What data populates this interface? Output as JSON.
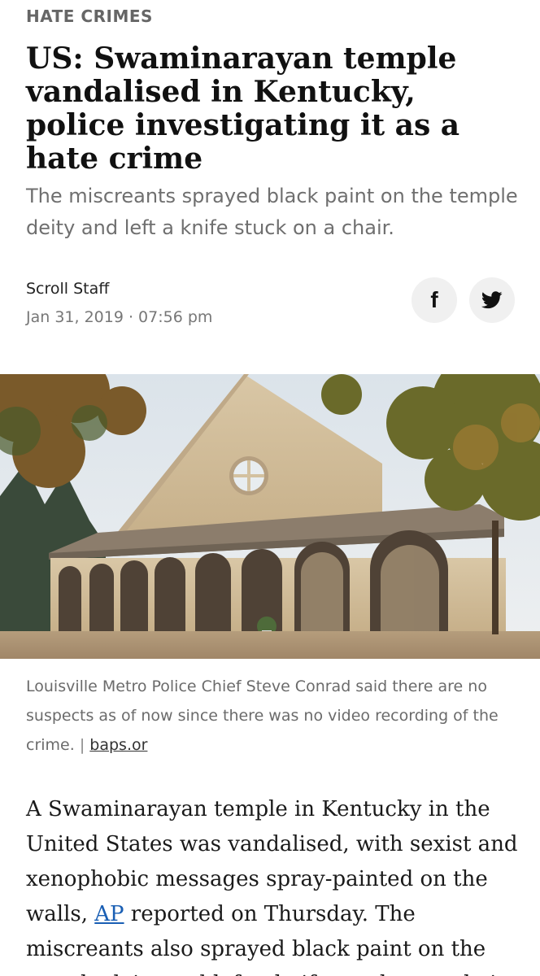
{
  "article": {
    "category": "HATE CRIMES",
    "headline": "US: Swaminarayan temple vandalised in Kentucky, police investigating it as a hate crime",
    "subheadline": "The miscreants sprayed black paint on the temple deity and left a knife stuck on a chair.",
    "author": "Scroll Staff",
    "date": "Jan 31, 2019 · 07:56 pm",
    "share": {
      "facebook_icon": "f",
      "twitter_icon": "twitter-bird"
    },
    "image": {
      "caption": "Louisville Metro Police Chief Steve Conrad said there are no suspects as of now since there was no video recording of the crime.",
      "separator": "|",
      "credit": "baps.or"
    },
    "body": {
      "text_before_link": "A Swaminarayan temple in Kentucky in the United States was vandalised, with sexist and xenophobic messages spray-painted on the walls, ",
      "link": "AP",
      "text_after_link": " reported on Thursday. The miscreants also sprayed black paint on the temple deity and left a knife stuck on a chair."
    }
  }
}
